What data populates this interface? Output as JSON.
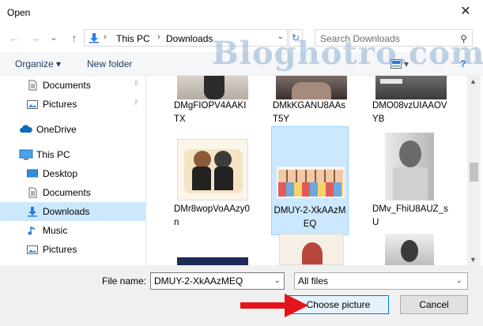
{
  "window": {
    "title": "Open",
    "close_glyph": "✕"
  },
  "navigation": {
    "back_glyph": "←",
    "forward_glyph": "→",
    "recent_glyph": "⌄",
    "up_glyph": "↑",
    "breadcrumb": [
      "This PC",
      "Downloads"
    ],
    "separator_glyph": "›",
    "dropdown_glyph": "⌄",
    "refresh_glyph": "↻",
    "search_placeholder": "Search Downloads",
    "search_glyph": "⚲"
  },
  "toolbar": {
    "organize_label": "Organize ▾",
    "new_folder_label": "New folder",
    "view_label": "▾",
    "help_label": "?"
  },
  "sidebar": {
    "items": [
      {
        "label": "Documents",
        "icon": "documents-icon",
        "pinned": true
      },
      {
        "label": "Pictures",
        "icon": "pictures-icon",
        "pinned": true
      },
      {
        "label": "OneDrive",
        "icon": "onedrive-icon"
      },
      {
        "label": "This PC",
        "icon": "this-pc-icon"
      },
      {
        "label": "Desktop",
        "icon": "desktop-icon"
      },
      {
        "label": "Documents",
        "icon": "documents-icon"
      },
      {
        "label": "Downloads",
        "icon": "downloads-icon",
        "selected": true
      },
      {
        "label": "Music",
        "icon": "music-icon"
      },
      {
        "label": "Pictures",
        "icon": "pictures-icon"
      }
    ],
    "pin_glyph": "📌"
  },
  "files": [
    {
      "name": "DMgFIOPV4AAKITX"
    },
    {
      "name": "DMkKGANU8AAsT5Y"
    },
    {
      "name": "DMO08vzUIAAOVYB"
    },
    {
      "name": "DMr8wopVoAAzy0n"
    },
    {
      "name": "DMUY-2-XkAAzMEQ",
      "selected": true
    },
    {
      "name": "DMv_FhiU8AUZ_sU"
    }
  ],
  "scroll": {
    "up_glyph": "▲",
    "down_glyph": "▼"
  },
  "footer": {
    "file_name_label": "File name:",
    "file_name_value": "DMUY-2-XkAAzMEQ",
    "file_type_value": "All files",
    "dropdown_glyph": "⌄",
    "choose_label": "Choose picture",
    "cancel_label": "Cancel"
  },
  "watermark": "Bloghotro.com",
  "colors": {
    "accent": "#0078d7",
    "selection": "#cce8ff",
    "arrow_annotation": "#e3141b"
  }
}
